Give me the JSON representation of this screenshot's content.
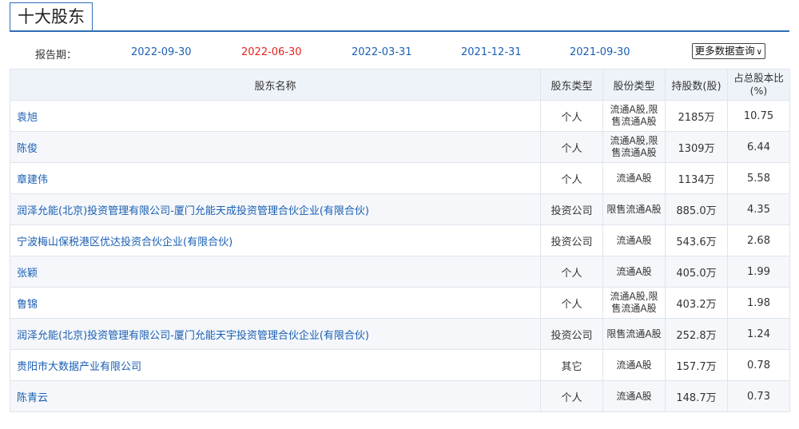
{
  "section": {
    "title": "十大股东"
  },
  "periods": {
    "label": "报告期：",
    "items": [
      "2022-09-30",
      "2022-06-30",
      "2022-03-31",
      "2021-12-31",
      "2021-09-30"
    ],
    "active": "2022-06-30",
    "more_button": "更多数据查询"
  },
  "table": {
    "headers": {
      "name": "股东名称",
      "holder_type": "股东类型",
      "share_type": "股份类型",
      "shares": "持股数(股)",
      "pct_line1": "占总股本比",
      "pct_line2": "(%)"
    },
    "rows": [
      {
        "name": "袁旭",
        "holder_type": "个人",
        "share_type_line1": "流通A股,限",
        "share_type_line2": "售流通A股",
        "shares": "2185万",
        "pct": "10.75"
      },
      {
        "name": "陈俊",
        "holder_type": "个人",
        "share_type_line1": "流通A股,限",
        "share_type_line2": "售流通A股",
        "shares": "1309万",
        "pct": "6.44"
      },
      {
        "name": "章建伟",
        "holder_type": "个人",
        "share_type_line1": "流通A股",
        "share_type_line2": "",
        "shares": "1134万",
        "pct": "5.58"
      },
      {
        "name": "润泽允能(北京)投资管理有限公司-厦门允能天成投资管理合伙企业(有限合伙)",
        "holder_type": "投资公司",
        "share_type_line1": "限售流通A股",
        "share_type_line2": "",
        "shares": "885.0万",
        "pct": "4.35"
      },
      {
        "name": "宁波梅山保税港区优达投资合伙企业(有限合伙)",
        "holder_type": "投资公司",
        "share_type_line1": "流通A股",
        "share_type_line2": "",
        "shares": "543.6万",
        "pct": "2.68"
      },
      {
        "name": "张颖",
        "holder_type": "个人",
        "share_type_line1": "流通A股",
        "share_type_line2": "",
        "shares": "405.0万",
        "pct": "1.99"
      },
      {
        "name": "鲁锦",
        "holder_type": "个人",
        "share_type_line1": "流通A股,限",
        "share_type_line2": "售流通A股",
        "shares": "403.2万",
        "pct": "1.98"
      },
      {
        "name": "润泽允能(北京)投资管理有限公司-厦门允能天宇投资管理合伙企业(有限合伙)",
        "holder_type": "投资公司",
        "share_type_line1": "限售流通A股",
        "share_type_line2": "",
        "shares": "252.8万",
        "pct": "1.24"
      },
      {
        "name": "贵阳市大数据产业有限公司",
        "holder_type": "其它",
        "share_type_line1": "流通A股",
        "share_type_line2": "",
        "shares": "157.7万",
        "pct": "0.78"
      },
      {
        "name": "陈青云",
        "holder_type": "个人",
        "share_type_line1": "流通A股",
        "share_type_line2": "",
        "shares": "148.7万",
        "pct": "0.73"
      }
    ]
  },
  "colors": {
    "accent": "#2f6eb5",
    "link": "#1a5fb4",
    "active_period": "#e8221f",
    "header_bg": "#eef3fa"
  }
}
